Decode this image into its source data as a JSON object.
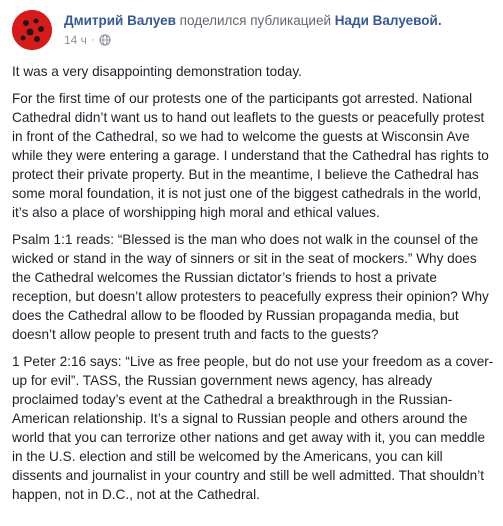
{
  "header": {
    "author": "Дмитрий Валуев",
    "shared_text": "поделился публикацией",
    "page_name": "Нади Валуевой.",
    "timestamp": "14 ч",
    "separator": "·",
    "privacy_icon": "globe-icon",
    "avatar_color": "#d91a1a"
  },
  "post": {
    "paragraphs": [
      "It was a very disappointing demonstration today.",
      "For the first time of our protests one of the participants got arrested. National Cathedral didn’t want us to hand out leaflets to the guests or peacefully protest in front of the Cathedral, so we had to welcome the guests at Wisconsin Ave while they were entering a garage. I understand that the Cathedral has rights to protect their private property. But in the meantime, I believe the Cathedral has some moral foundation, it is not just one of the biggest cathedrals in the world, it’s also a place of worshipping high moral and ethical values.",
      "Psalm 1:1 reads: “Blessed is the man who does not walk in the counsel of the wicked or stand in the way of sinners or sit in the seat of mockers.” Why does the Cathedral welcomes the Russian dictator’s friends to host a private reception, but doesn’t allow protesters to peacefully express their opinion? Why does the Cathedral allow to be flooded by Russian propaganda media, but doesn’t allow people to present truth and facts to the guests?",
      "1 Peter 2:16 says: “Live as free people, but do not use your freedom as a cover-up for evil”. TASS, the Russian government news agency, has already proclaimed today’s event at the Cathedral a breakthrough in the Russian-American relationship. It’s a signal to Russian people and others around the world that you can terrorize other nations and get away with it, you can meddle in the U.S. election and still be welcomed by the Americans, you can kill dissents and journalist in your country and still be well admitted. That shouldn’t happen, not in D.C., not at the Cathedral."
    ]
  }
}
